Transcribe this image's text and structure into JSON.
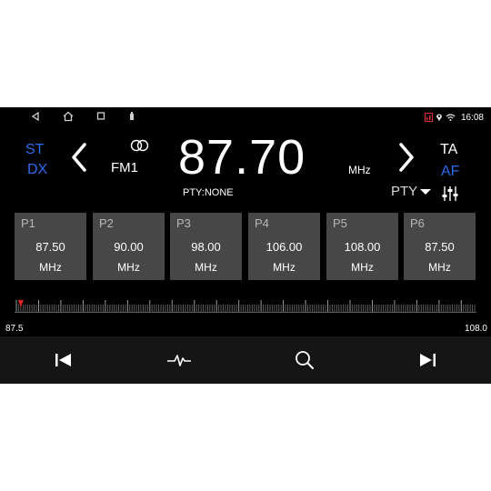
{
  "status_bar": {
    "time": "16:08",
    "nav_icons": [
      "back-icon",
      "home-icon",
      "recents-icon",
      "usb-icon"
    ],
    "status_icons": [
      "signal-icon",
      "location-icon",
      "wifi-icon"
    ],
    "accent_color": "#e03030"
  },
  "radio": {
    "st_label": "ST",
    "dx_label": "DX",
    "band": "FM1",
    "frequency": "87.70",
    "unit": "MHz",
    "ta_label": "TA",
    "af_label": "AF",
    "pty_status": "PTY:NONE",
    "pty_dropdown": "PTY",
    "accent_color": "#2a6cf0"
  },
  "presets": [
    {
      "label": "P1",
      "frequency": "87.50",
      "unit": "MHz"
    },
    {
      "label": "P2",
      "frequency": "90.00",
      "unit": "MHz"
    },
    {
      "label": "P3",
      "frequency": "98.00",
      "unit": "MHz"
    },
    {
      "label": "P4",
      "frequency": "106.00",
      "unit": "MHz"
    },
    {
      "label": "P5",
      "frequency": "108.00",
      "unit": "MHz"
    },
    {
      "label": "P6",
      "frequency": "87.50",
      "unit": "MHz"
    }
  ],
  "scale": {
    "min": "87.5",
    "max": "108.0",
    "current": 87.7,
    "marker_color": "#e02020"
  },
  "controls": [
    "previous-icon",
    "scan-wave-icon",
    "search-icon",
    "next-icon"
  ]
}
